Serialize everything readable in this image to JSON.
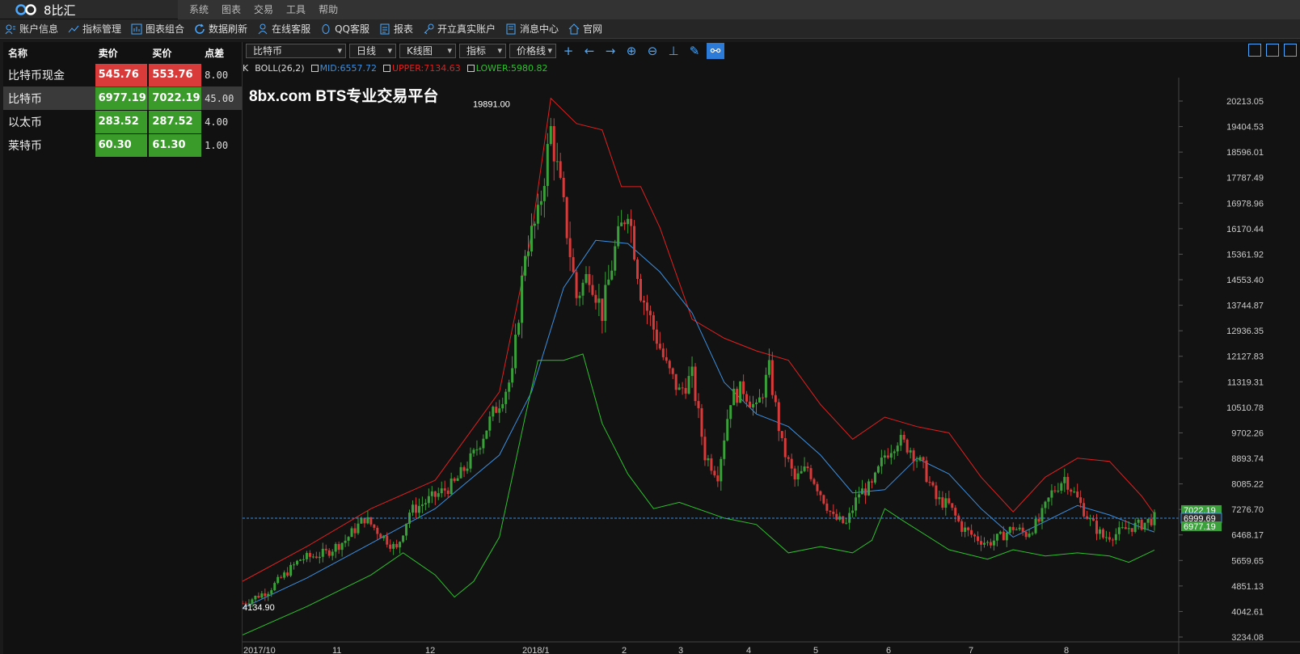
{
  "app": {
    "title": "8比汇"
  },
  "menu": [
    "系统",
    "图表",
    "交易",
    "工具",
    "帮助"
  ],
  "toolbar": [
    {
      "label": "账户信息",
      "icon": "account-icon"
    },
    {
      "label": "指标管理",
      "icon": "indicator-icon"
    },
    {
      "label": "图表组合",
      "icon": "chart-combo-icon"
    },
    {
      "label": "数据刷新",
      "icon": "refresh-icon"
    },
    {
      "label": "在线客服",
      "icon": "user-icon"
    },
    {
      "label": "QQ客服",
      "icon": "qq-icon"
    },
    {
      "label": "报表",
      "icon": "report-icon"
    },
    {
      "label": "开立真实账户",
      "icon": "key-icon"
    },
    {
      "label": "消息中心",
      "icon": "message-icon"
    },
    {
      "label": "官网",
      "icon": "home-icon"
    }
  ],
  "quotes": {
    "headers": [
      "名称",
      "卖价",
      "买价",
      "点差"
    ],
    "rows": [
      {
        "name": "比特币现金",
        "sell": "545.76",
        "buy": "553.76",
        "spread": "8.00",
        "sell_color": "red",
        "buy_color": "red",
        "selected": false
      },
      {
        "name": "比特币",
        "sell": "6977.19",
        "buy": "7022.19",
        "spread": "45.00",
        "sell_color": "green",
        "buy_color": "green",
        "selected": true
      },
      {
        "name": "以太币",
        "sell": "283.52",
        "buy": "287.52",
        "spread": "4.00",
        "sell_color": "green",
        "buy_color": "green",
        "selected": false
      },
      {
        "name": "莱特币",
        "sell": "60.30",
        "buy": "61.30",
        "spread": "1.00",
        "sell_color": "green",
        "buy_color": "green",
        "selected": false
      }
    ]
  },
  "chart_toolbar": {
    "symbol": "比特币",
    "period": "日线",
    "chart_type": "K线图",
    "indicator": "指标",
    "line_type": "价格线"
  },
  "legend": {
    "k": "K",
    "boll": "BOLL(26,2)",
    "mid": "MID:6557.72",
    "upper": "UPPER:7134.63",
    "lower": "LOWER:5980.82"
  },
  "colors": {
    "mid": "#3b8fe0",
    "upper": "#e02020",
    "lower": "#2ec02e",
    "up": "#3aa03a",
    "down": "#d83a3a"
  },
  "watermark": "8bx.com BTS专业交易平台",
  "chart_data": {
    "type": "candlestick",
    "high_label": "19891.00",
    "low_label": "4134.90",
    "ylim": [
      3000,
      21000
    ],
    "y_ticks": [
      "20213.05",
      "19404.53",
      "18596.01",
      "17787.49",
      "16978.96",
      "16170.44",
      "15361.92",
      "14553.40",
      "13744.87",
      "12936.35",
      "12127.83",
      "11319.31",
      "10510.78",
      "9702.26",
      "8893.74",
      "8085.22",
      "7276.70",
      "6468.17",
      "5659.65",
      "4851.13",
      "4042.61",
      "3234.08"
    ],
    "x_ticks": [
      "2017/10",
      "11",
      "12",
      "2018/1",
      "2",
      "3",
      "4",
      "5",
      "6",
      "7",
      "8"
    ],
    "price_tags": {
      "buy": "7022.19",
      "current": "6999.69",
      "sell": "6977.19"
    },
    "current_price": 6999.69,
    "close_path": [
      [
        0,
        4300
      ],
      [
        8,
        4700
      ],
      [
        18,
        5700
      ],
      [
        26,
        5900
      ],
      [
        32,
        6300
      ],
      [
        38,
        7000
      ],
      [
        44,
        6400
      ],
      [
        48,
        6000
      ],
      [
        52,
        7200
      ],
      [
        60,
        7700
      ],
      [
        66,
        8100
      ],
      [
        72,
        9000
      ],
      [
        78,
        10300
      ],
      [
        84,
        11500
      ],
      [
        88,
        15500
      ],
      [
        92,
        16500
      ],
      [
        96,
        19300
      ],
      [
        100,
        16800
      ],
      [
        104,
        14000
      ],
      [
        108,
        14800
      ],
      [
        112,
        13500
      ],
      [
        116,
        15500
      ],
      [
        120,
        16900
      ],
      [
        124,
        14200
      ],
      [
        128,
        13000
      ],
      [
        132,
        11800
      ],
      [
        136,
        11000
      ],
      [
        140,
        11500
      ],
      [
        144,
        9000
      ],
      [
        148,
        8400
      ],
      [
        152,
        10800
      ],
      [
        156,
        11100
      ],
      [
        160,
        10400
      ],
      [
        164,
        11700
      ],
      [
        168,
        9300
      ],
      [
        172,
        8200
      ],
      [
        176,
        8600
      ],
      [
        180,
        7800
      ],
      [
        184,
        7000
      ],
      [
        188,
        6800
      ],
      [
        192,
        7800
      ],
      [
        196,
        8000
      ],
      [
        200,
        9000
      ],
      [
        204,
        9500
      ],
      [
        208,
        9200
      ],
      [
        212,
        8600
      ],
      [
        216,
        7600
      ],
      [
        220,
        7400
      ],
      [
        224,
        6700
      ],
      [
        228,
        6400
      ],
      [
        232,
        6200
      ],
      [
        236,
        6400
      ],
      [
        240,
        6700
      ],
      [
        244,
        6500
      ],
      [
        248,
        6900
      ],
      [
        252,
        7800
      ],
      [
        256,
        8300
      ],
      [
        260,
        7600
      ],
      [
        264,
        6900
      ],
      [
        268,
        6400
      ],
      [
        272,
        6500
      ],
      [
        276,
        6700
      ],
      [
        280,
        6800
      ],
      [
        284,
        7000
      ]
    ],
    "mid_path": [
      [
        0,
        4150
      ],
      [
        20,
        5100
      ],
      [
        40,
        6200
      ],
      [
        60,
        7300
      ],
      [
        80,
        9000
      ],
      [
        90,
        11000
      ],
      [
        100,
        14300
      ],
      [
        110,
        15800
      ],
      [
        120,
        15700
      ],
      [
        130,
        14800
      ],
      [
        140,
        13500
      ],
      [
        150,
        11300
      ],
      [
        160,
        10300
      ],
      [
        170,
        9900
      ],
      [
        180,
        9000
      ],
      [
        190,
        7800
      ],
      [
        200,
        7900
      ],
      [
        210,
        8900
      ],
      [
        220,
        8400
      ],
      [
        230,
        7300
      ],
      [
        240,
        6400
      ],
      [
        250,
        6900
      ],
      [
        260,
        7400
      ],
      [
        270,
        7100
      ],
      [
        280,
        6700
      ],
      [
        284,
        6560
      ]
    ],
    "upper_path": [
      [
        0,
        5000
      ],
      [
        20,
        6100
      ],
      [
        40,
        7300
      ],
      [
        60,
        8200
      ],
      [
        80,
        11000
      ],
      [
        90,
        16000
      ],
      [
        96,
        20300
      ],
      [
        104,
        19500
      ],
      [
        112,
        19300
      ],
      [
        118,
        17500
      ],
      [
        124,
        17500
      ],
      [
        130,
        16200
      ],
      [
        140,
        13300
      ],
      [
        150,
        12700
      ],
      [
        160,
        12300
      ],
      [
        170,
        12000
      ],
      [
        180,
        10600
      ],
      [
        190,
        9500
      ],
      [
        200,
        10200
      ],
      [
        210,
        9900
      ],
      [
        220,
        9700
      ],
      [
        230,
        8300
      ],
      [
        240,
        7200
      ],
      [
        250,
        8300
      ],
      [
        260,
        8900
      ],
      [
        270,
        8800
      ],
      [
        280,
        7700
      ],
      [
        284,
        7130
      ]
    ],
    "lower_path": [
      [
        0,
        3300
      ],
      [
        20,
        4200
      ],
      [
        40,
        5200
      ],
      [
        50,
        5900
      ],
      [
        60,
        5200
      ],
      [
        66,
        4500
      ],
      [
        72,
        5000
      ],
      [
        80,
        6400
      ],
      [
        88,
        10200
      ],
      [
        92,
        12000
      ],
      [
        100,
        12000
      ],
      [
        106,
        12200
      ],
      [
        112,
        10000
      ],
      [
        120,
        8400
      ],
      [
        128,
        7300
      ],
      [
        136,
        7500
      ],
      [
        150,
        7000
      ],
      [
        160,
        6800
      ],
      [
        170,
        5900
      ],
      [
        180,
        6100
      ],
      [
        190,
        5900
      ],
      [
        196,
        6300
      ],
      [
        200,
        7300
      ],
      [
        206,
        6900
      ],
      [
        220,
        6000
      ],
      [
        232,
        5700
      ],
      [
        240,
        6000
      ],
      [
        250,
        5800
      ],
      [
        260,
        5900
      ],
      [
        270,
        5800
      ],
      [
        276,
        5600
      ],
      [
        284,
        5990
      ]
    ]
  }
}
